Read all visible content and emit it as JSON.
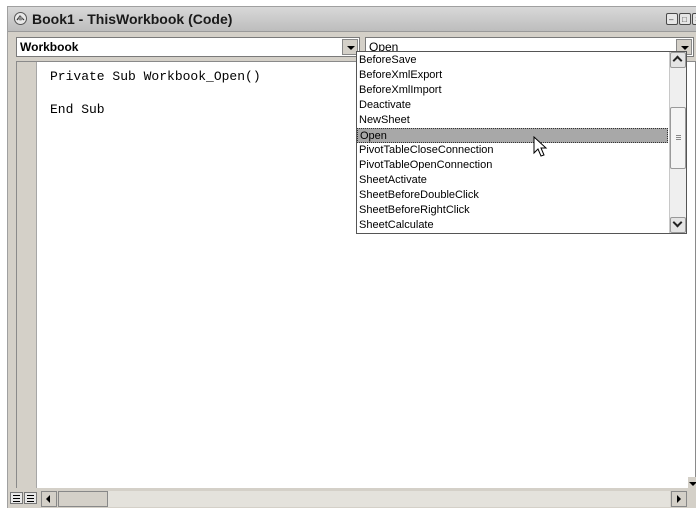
{
  "window": {
    "title": "Book1 - ThisWorkbook (Code)",
    "icon": "vba-module-icon",
    "controls": [
      "minimize-icon",
      "restore-icon",
      "close-icon"
    ]
  },
  "object_dropdown": {
    "value": "Workbook"
  },
  "procedure_dropdown": {
    "value": "Open",
    "options": [
      "BeforeSave",
      "BeforeXmlExport",
      "BeforeXmlImport",
      "Deactivate",
      "NewSheet",
      "Open",
      "PivotTableCloseConnection",
      "PivotTableOpenConnection",
      "SheetActivate",
      "SheetBeforeDoubleClick",
      "SheetBeforeRightClick",
      "SheetCalculate"
    ],
    "selected": "Open"
  },
  "code": {
    "lines": [
      "Private Sub Workbook_Open()",
      "",
      "End Sub"
    ]
  },
  "colors": {
    "selection": "#a8a8a8",
    "chrome": "#d4d0c8"
  }
}
